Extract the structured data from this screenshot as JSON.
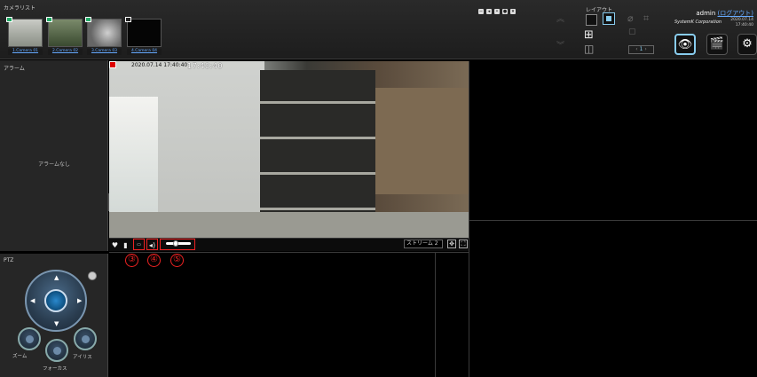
{
  "camera_list": {
    "title": "カメラリスト",
    "cameras": [
      {
        "label": "1.Camera 01"
      },
      {
        "label": "2.Camera 02"
      },
      {
        "label": "3.Camera 03"
      },
      {
        "label": "4.Camera 04"
      }
    ]
  },
  "layout": {
    "title": "レイアウト",
    "page": "1"
  },
  "user": {
    "name": "admin",
    "logout": "(ログアウト)",
    "brand": "SystemK Corporation",
    "date": "2020.07.14",
    "time": "17:40:40"
  },
  "alarm": {
    "title": "アラーム",
    "empty": "アラームなし"
  },
  "video": {
    "osd_date": "2020.07.14 17:40:40",
    "osd_clock": "17:40:40"
  },
  "controls": {
    "stream": "ストリーム 2",
    "callouts": [
      "③",
      "④",
      "⑤"
    ],
    "volume_level_percent": 35
  },
  "ptz": {
    "title": "PTZ",
    "zoom": "ズーム",
    "focus": "フォーカス",
    "iris": "アイリス"
  },
  "colors": {
    "accent": "#88ccee",
    "highlight": "#ee2222",
    "link": "#66aaff"
  }
}
